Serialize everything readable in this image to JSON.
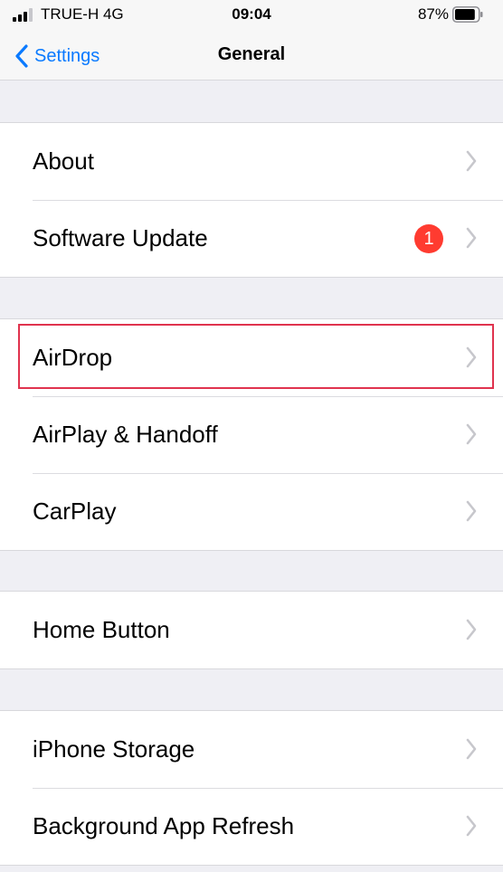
{
  "status_bar": {
    "carrier": "TRUE-H  4G",
    "time": "09:04",
    "battery_percent": "87%",
    "battery_level": 0.87,
    "signal_bars": 3
  },
  "nav": {
    "back_label": "Settings",
    "title": "General",
    "accent_color": "#0a7aff"
  },
  "groups": [
    {
      "rows": [
        {
          "label": "About"
        },
        {
          "label": "Software Update",
          "badge": "1"
        }
      ]
    },
    {
      "rows": [
        {
          "label": "AirDrop",
          "highlighted": true
        },
        {
          "label": "AirPlay & Handoff"
        },
        {
          "label": "CarPlay"
        }
      ]
    },
    {
      "rows": [
        {
          "label": "Home Button"
        }
      ]
    },
    {
      "rows": [
        {
          "label": "iPhone Storage"
        },
        {
          "label": "Background App Refresh"
        }
      ]
    }
  ],
  "badge_color": "#ff3b30",
  "highlight_color": "#e0334e"
}
